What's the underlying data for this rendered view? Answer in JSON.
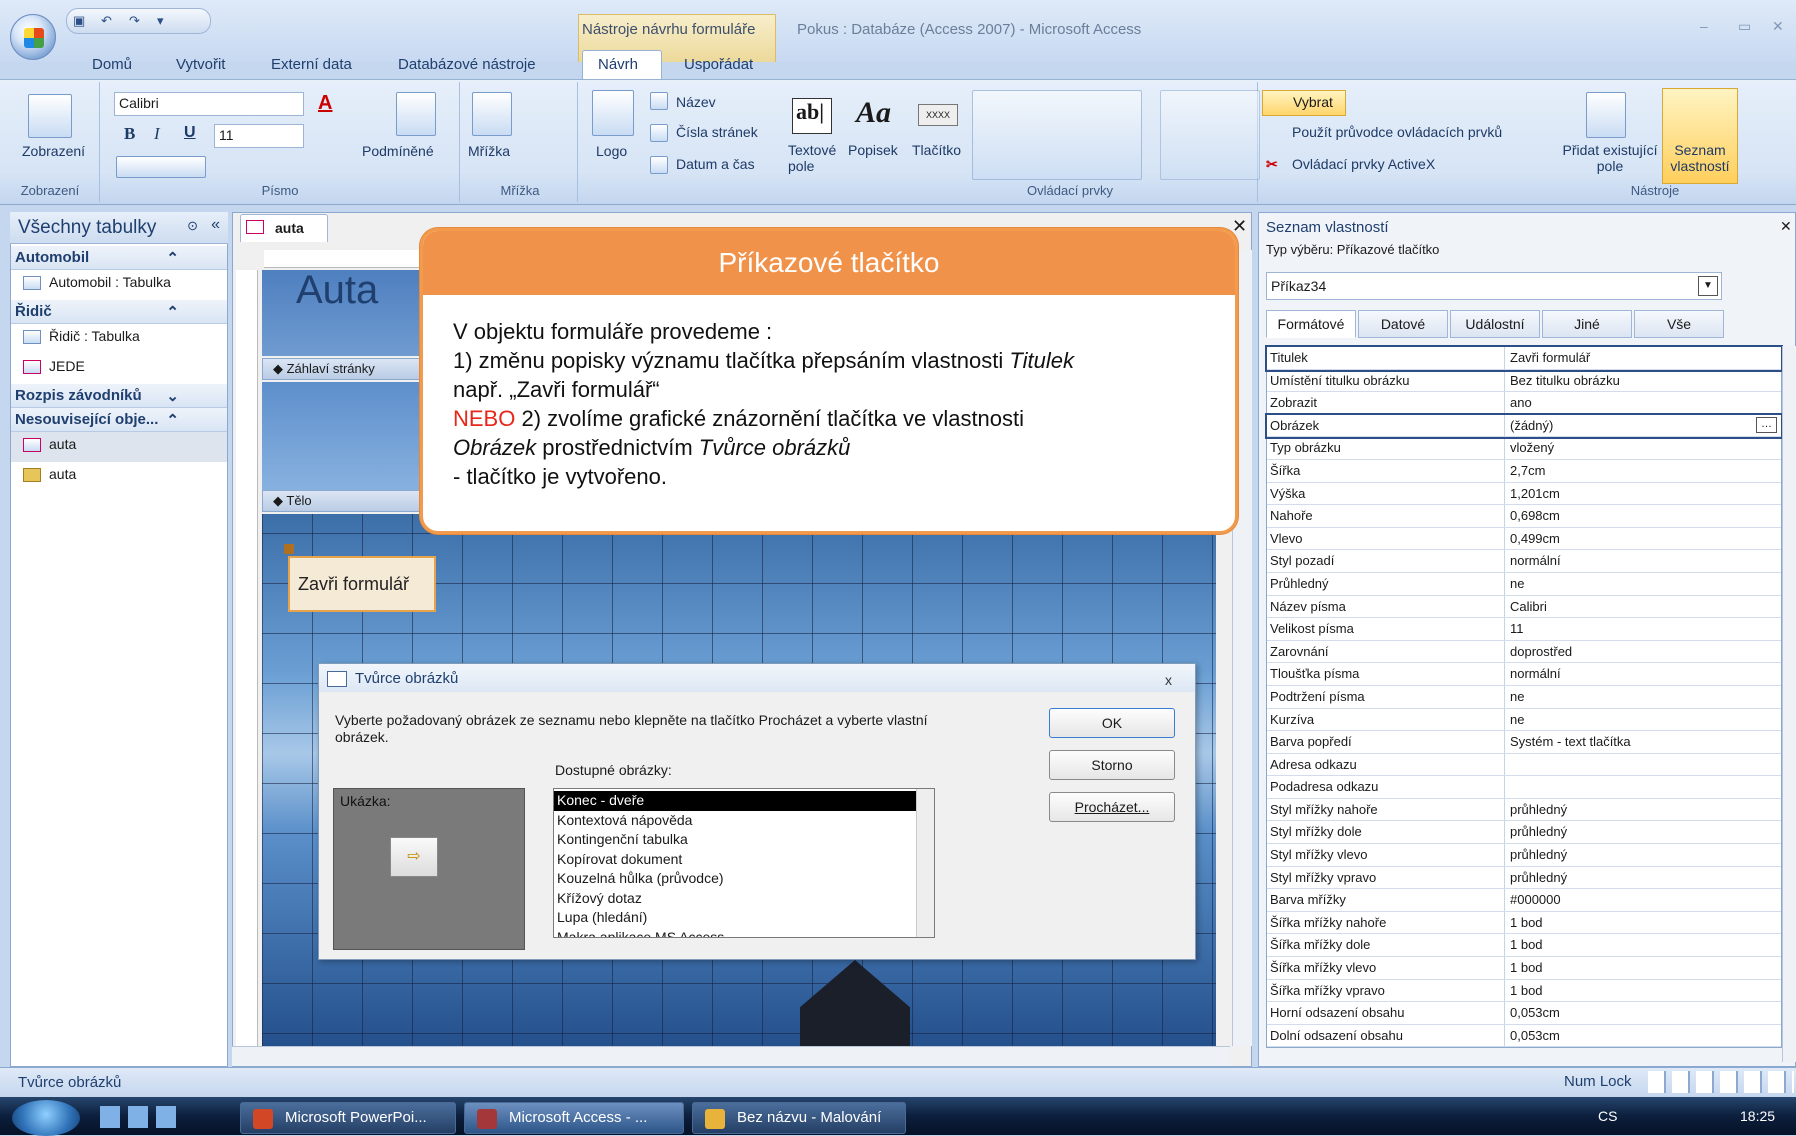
{
  "window": {
    "context_tab_group": "Nástroje návrhu formuláře",
    "title": "Pokus : Databáze (Access 2007) - Microsoft Access",
    "min": "–",
    "max": "▭",
    "close": "✕"
  },
  "ribbon_tabs": [
    "Domů",
    "Vytvořit",
    "Externí data",
    "Databázové nástroje",
    "Návrh",
    "Uspořádat"
  ],
  "ribbon": {
    "zobrazeni": {
      "label": "Zobrazení",
      "group": "Zobrazení"
    },
    "pismo": {
      "font": "Calibri",
      "size": "11",
      "group": "Písmo",
      "podminene": "Podmíněné",
      "bold": "B",
      "italic": "I",
      "underline": "U",
      "color": "A"
    },
    "mrizka": {
      "label": "Mřížka",
      "group": "Mřížka"
    },
    "ovladaci": {
      "logo": "Logo",
      "nazev": "Název",
      "cisla": "Čísla stránek",
      "datum": "Datum a čas",
      "textove": "Textové pole",
      "popisek": "Popisek",
      "tlacitko": "Tlačítko",
      "vybrat": "Vybrat",
      "pruvodce": "Použít průvodce ovládacích prvků",
      "activex": "Ovládací prvky ActiveX",
      "group": "Ovládací prvky",
      "abl": "ab|",
      "aa": "Aa",
      "xxxx": "XXXX"
    },
    "nastroje": {
      "pridat": "Přidat existující pole",
      "seznam": "Seznam vlastností",
      "group": "Nástroje"
    }
  },
  "nav": {
    "header": "Všechny tabulky",
    "sections": [
      {
        "title": "Automobil",
        "items": [
          "Automobil : Tabulka"
        ]
      },
      {
        "title": "Řidič",
        "items": [
          "Řidič : Tabulka",
          "JEDE"
        ]
      },
      {
        "title": "Rozpis závodníků",
        "items": []
      },
      {
        "title": "Nesouvisející obje...",
        "items": [
          "auta",
          "auta"
        ]
      }
    ]
  },
  "form": {
    "tab": "auta",
    "heading": "Auta",
    "header_section": "Záhlaví stránky",
    "body_section": "Tělo",
    "button_caption": "Zavři formulář"
  },
  "callout": {
    "title": "Příkazové tlačítko",
    "line1": "V objektu formuláře provedeme :",
    "line2a": "1) změnu popisky významu tlačítka přepsáním vlastnosti ",
    "line2b": "Titulek",
    "line3": "např. „Zavři formulář“",
    "line4a": "NEBO",
    "line4b": " 2) zvolíme grafické znázornění tlačítka ve vlastnosti",
    "line5a": "Obrázek",
    "line5b": " prostřednictvím ",
    "line5c": "Tvůrce obrázků",
    "line6": "- tlačítko je vytvořeno.",
    "accent": "#f0924a"
  },
  "dialog": {
    "title": "Tvůrce obrázků",
    "instruction": "Vyberte požadovaný obrázek ze seznamu nebo klepněte na tlačítko Procházet a vyberte vlastní obrázek.",
    "available": "Dostupné obrázky:",
    "preview": "Ukázka:",
    "ok": "OK",
    "cancel": "Storno",
    "browse": "Procházet...",
    "close": "x",
    "images": [
      "Konec - dveře",
      "Kontextová nápověda",
      "Kontingenční tabulka",
      "Kopírovat dokument",
      "Kouzelná hůlka (průvodce)",
      "Křížový dotaz",
      "Lupa (hledání)",
      "Makra aplikace MS Access"
    ]
  },
  "props": {
    "title": "Seznam vlastností",
    "selection_label": "Typ výběru:  Příkazové tlačítko",
    "object": "Příkaz34",
    "tabs": [
      "Formátové",
      "Datové",
      "Událostní",
      "Jiné",
      "Vše"
    ],
    "rows": [
      [
        "Titulek",
        "Zavři formulář"
      ],
      [
        "Umístění titulku obrázku",
        "Bez titulku obrázku"
      ],
      [
        "Zobrazit",
        "ano"
      ],
      [
        "Obrázek",
        "(žádný)"
      ],
      [
        "Typ obrázku",
        "vložený"
      ],
      [
        "Šířka",
        "2,7cm"
      ],
      [
        "Výška",
        "1,201cm"
      ],
      [
        "Nahoře",
        "0,698cm"
      ],
      [
        "Vlevo",
        "0,499cm"
      ],
      [
        "Styl pozadí",
        "normální"
      ],
      [
        "Průhledný",
        "ne"
      ],
      [
        "Název písma",
        "Calibri"
      ],
      [
        "Velikost písma",
        "11"
      ],
      [
        "Zarovnání",
        "doprostřed"
      ],
      [
        "Tloušťka písma",
        "normální"
      ],
      [
        "Podtržení písma",
        "ne"
      ],
      [
        "Kurzíva",
        "ne"
      ],
      [
        "Barva popředí",
        "Systém - text tlačítka"
      ],
      [
        "Adresa odkazu",
        ""
      ],
      [
        "Podadresa odkazu",
        ""
      ],
      [
        "Styl mřížky nahoře",
        "průhledný"
      ],
      [
        "Styl mřížky dole",
        "průhledný"
      ],
      [
        "Styl mřížky vlevo",
        "průhledný"
      ],
      [
        "Styl mřížky vpravo",
        "průhledný"
      ],
      [
        "Barva mřížky",
        "#000000"
      ],
      [
        "Šířka mřížky nahoře",
        "1 bod"
      ],
      [
        "Šířka mřížky dole",
        "1 bod"
      ],
      [
        "Šířka mřížky vlevo",
        "1 bod"
      ],
      [
        "Šířka mřížky vpravo",
        "1 bod"
      ],
      [
        "Horní odsazení obsahu",
        "0,053cm"
      ],
      [
        "Dolní odsazení obsahu",
        "0,053cm"
      ]
    ]
  },
  "status": {
    "left": "Tvůrce obrázků",
    "numlock": "Num Lock"
  },
  "taskbar": {
    "tasks": [
      "Microsoft PowerPoi...",
      "Microsoft Access - ...",
      "Bez názvu - Malování"
    ],
    "lang": "CS",
    "time": "18:25"
  }
}
